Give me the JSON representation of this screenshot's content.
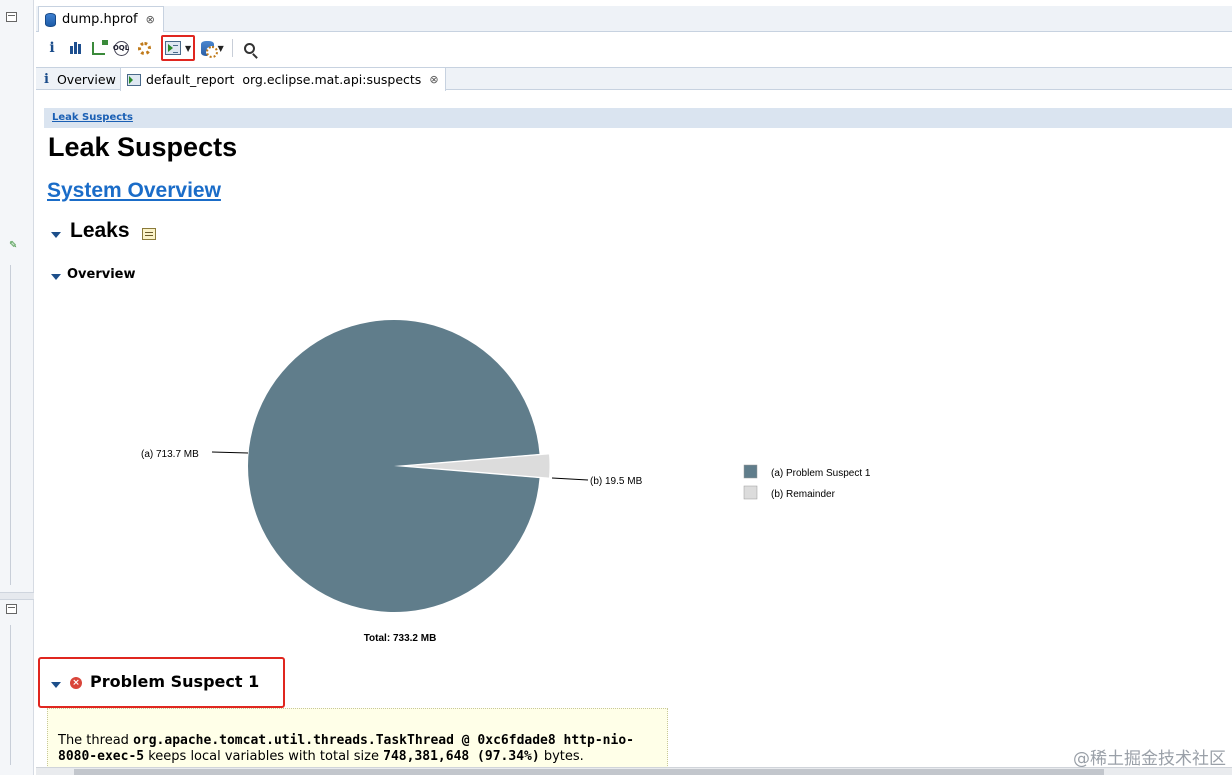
{
  "editor": {
    "tab_label": "dump.hprof",
    "tab_close": "⊗"
  },
  "toolbar": {
    "info_label": "i",
    "oql_label": "OQL"
  },
  "sub_tabs": {
    "overview_label": "Overview",
    "report_label": "default_report  org.eclipse.mat.api:suspects",
    "report_close": "⊗"
  },
  "report": {
    "breadcrumb": "Leak Suspects",
    "title": "Leak Suspects",
    "system_overview_link": "System Overview",
    "leaks_heading": "Leaks",
    "overview_heading": "Overview",
    "suspect_heading": "Problem Suspect 1",
    "description": {
      "p1": "The thread ",
      "thread": "org.apache.tomcat.util.threads.TaskThread @ 0xc6fdade8 http-nio-8080-exec-5",
      "p2": " keeps local variables with total size ",
      "size": "748,381,648 (97.34%)",
      "p3": " bytes."
    }
  },
  "chart_data": {
    "type": "pie",
    "total_label": "Total: 733.2 MB",
    "slices": [
      {
        "label": "(a)  713.7 MB",
        "value": 713.7,
        "legend": "(a)  Problem Suspect 1",
        "color": "#607d8b"
      },
      {
        "label": "(b)  19.5 MB",
        "value": 19.5,
        "legend": "(b)  Remainder",
        "color": "#dcdcdc"
      }
    ],
    "exploded_slice": "(b)",
    "legend_position": "right"
  },
  "watermark": "@稀土掘金技术社区"
}
